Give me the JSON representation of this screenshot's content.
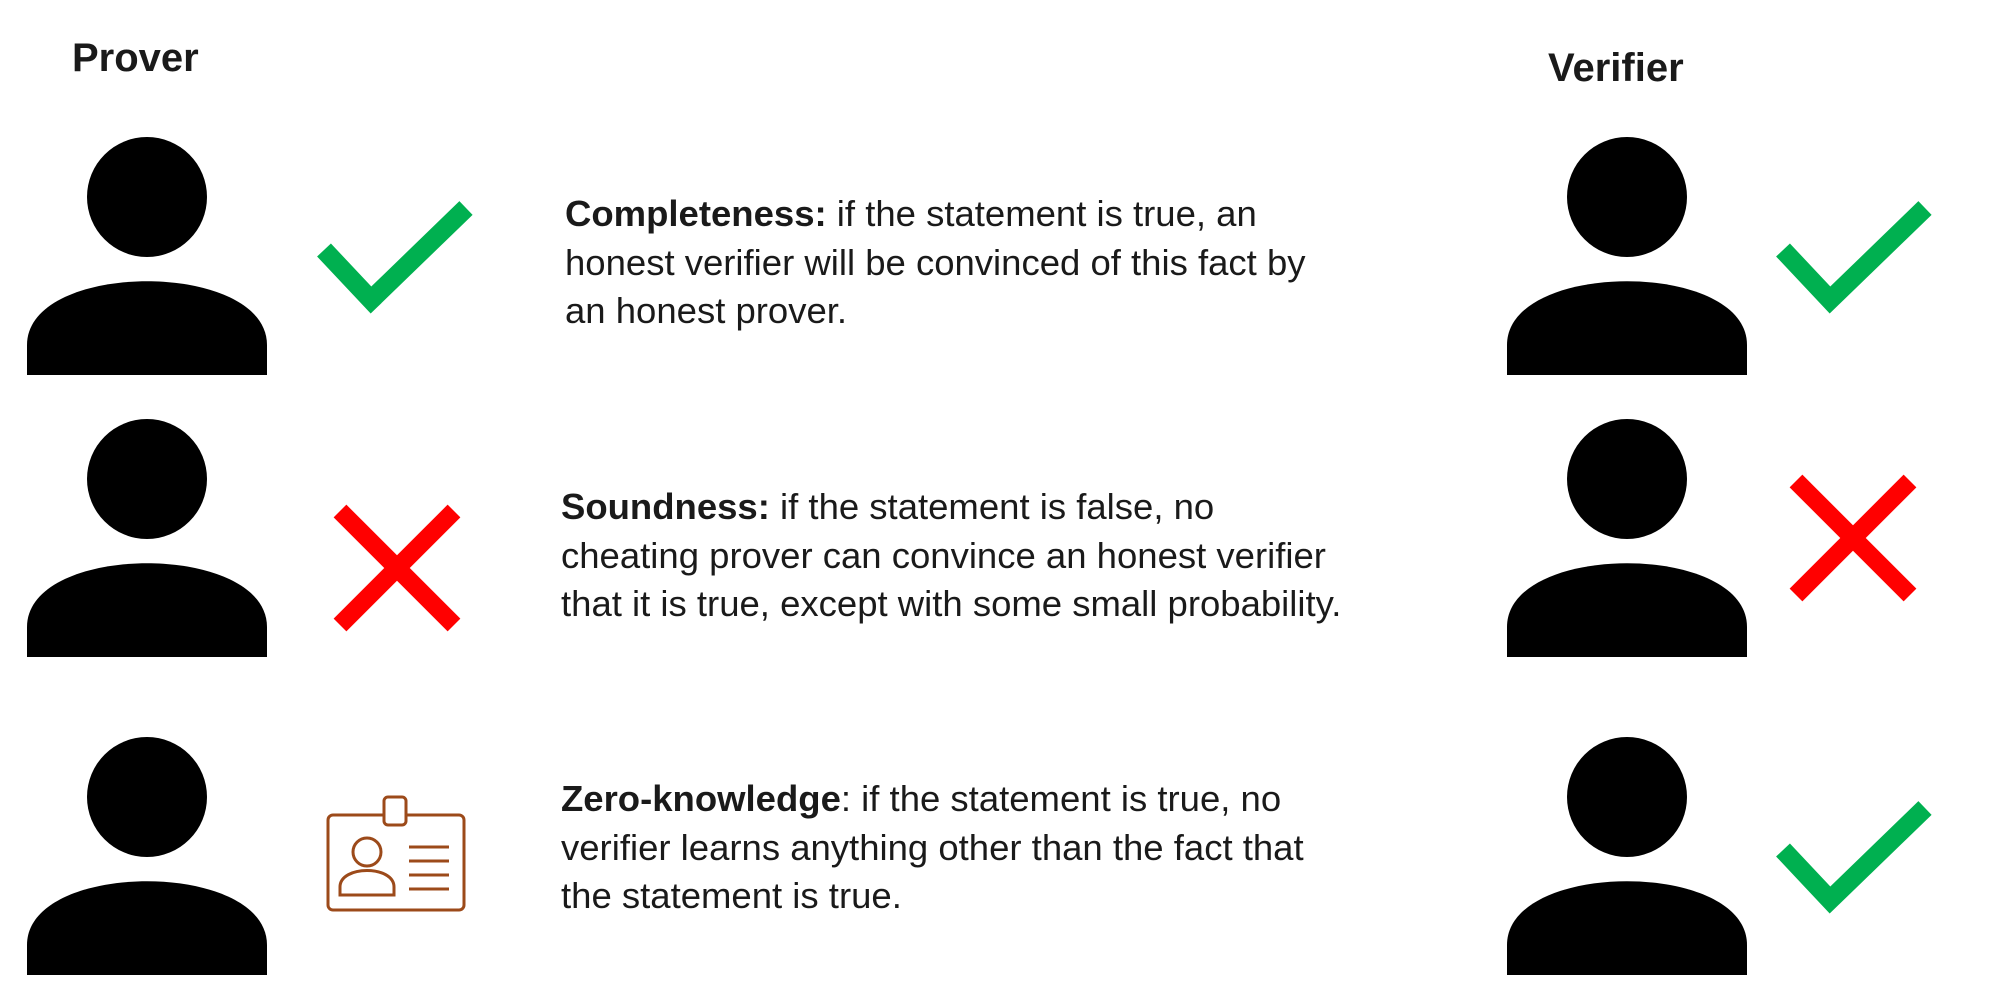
{
  "headers": {
    "prover": "Prover",
    "verifier": "Verifier"
  },
  "colors": {
    "figure": "#000000",
    "check": "#00b050",
    "cross": "#ff0000",
    "badge": "#9c4a1a",
    "text": "#1a1a1a"
  },
  "rows": [
    {
      "term": "Completeness:",
      "lines": [
        " if the statement is true, an",
        "honest verifier will be convinced of this fact by",
        "an honest prover."
      ],
      "prover_symbol": "check-icon",
      "verifier_symbol": "check-icon"
    },
    {
      "term": "Soundness:",
      "lines": [
        " if the statement is false, no",
        "cheating prover can convince an honest verifier",
        "that it is true, except with some small probability."
      ],
      "prover_symbol": "cross-icon",
      "verifier_symbol": "cross-icon"
    },
    {
      "term": "Zero-knowledge",
      "lines": [
        ": if the statement is true, no",
        "verifier learns anything other than the fact that",
        "the statement is true."
      ],
      "prover_symbol": "id-badge-icon",
      "verifier_symbol": "check-icon"
    }
  ]
}
